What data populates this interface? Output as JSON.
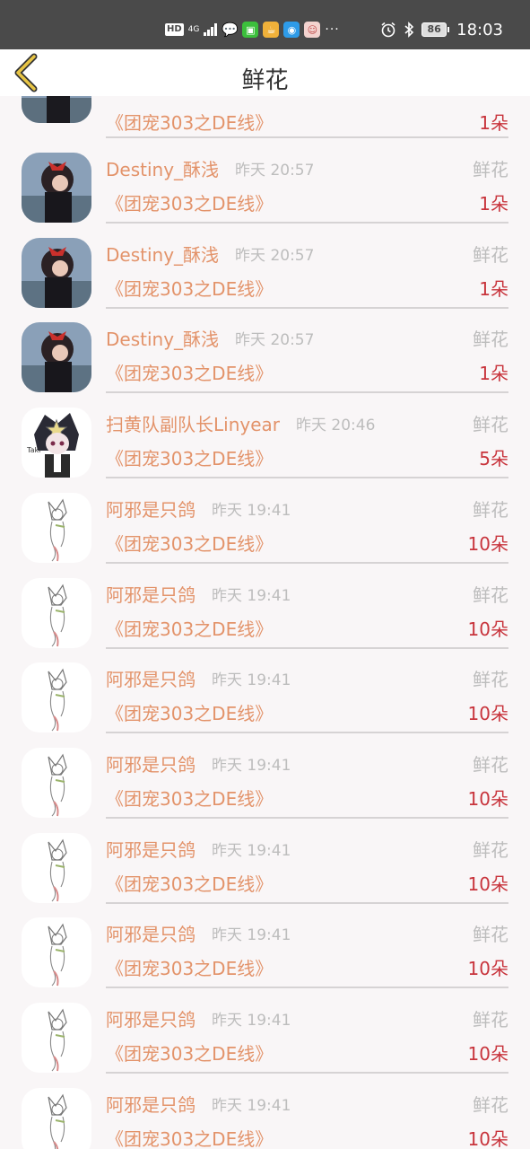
{
  "status_bar": {
    "hd": "HD",
    "network": "4G",
    "dots": "···",
    "battery": "86",
    "time": "18:03"
  },
  "header": {
    "title": "鲜花"
  },
  "list": {
    "partial_first": {
      "work": "《团宠303之DE线》",
      "count": "1朵"
    },
    "rows": [
      {
        "name": "Destiny_酥浅",
        "time": "昨天 20:57",
        "label": "鲜花",
        "work": "《团宠303之DE线》",
        "count": "1朵",
        "avatar": "girl-avatar"
      },
      {
        "name": "Destiny_酥浅",
        "time": "昨天 20:57",
        "label": "鲜花",
        "work": "《团宠303之DE线》",
        "count": "1朵",
        "avatar": "girl-avatar"
      },
      {
        "name": "Destiny_酥浅",
        "time": "昨天 20:57",
        "label": "鲜花",
        "work": "《团宠303之DE线》",
        "count": "1朵",
        "avatar": "girl-avatar"
      },
      {
        "name": "扫黄队副队长Linyear",
        "time": "昨天 20:46",
        "label": "鲜花",
        "work": "《团宠303之DE线》",
        "count": "5朵",
        "avatar": "chibi-avatar"
      },
      {
        "name": "阿邪是只鸽",
        "time": "昨天 19:41",
        "label": "鲜花",
        "work": "《团宠303之DE线》",
        "count": "10朵",
        "avatar": "sketch-avatar"
      },
      {
        "name": "阿邪是只鸽",
        "time": "昨天 19:41",
        "label": "鲜花",
        "work": "《团宠303之DE线》",
        "count": "10朵",
        "avatar": "sketch-avatar"
      },
      {
        "name": "阿邪是只鸽",
        "time": "昨天 19:41",
        "label": "鲜花",
        "work": "《团宠303之DE线》",
        "count": "10朵",
        "avatar": "sketch-avatar"
      },
      {
        "name": "阿邪是只鸽",
        "time": "昨天 19:41",
        "label": "鲜花",
        "work": "《团宠303之DE线》",
        "count": "10朵",
        "avatar": "sketch-avatar"
      },
      {
        "name": "阿邪是只鸽",
        "time": "昨天 19:41",
        "label": "鲜花",
        "work": "《团宠303之DE线》",
        "count": "10朵",
        "avatar": "sketch-avatar"
      },
      {
        "name": "阿邪是只鸽",
        "time": "昨天 19:41",
        "label": "鲜花",
        "work": "《团宠303之DE线》",
        "count": "10朵",
        "avatar": "sketch-avatar"
      },
      {
        "name": "阿邪是只鸽",
        "time": "昨天 19:41",
        "label": "鲜花",
        "work": "《团宠303之DE线》",
        "count": "10朵",
        "avatar": "sketch-avatar"
      },
      {
        "name": "阿邪是只鸽",
        "time": "昨天 19:41",
        "label": "鲜花",
        "work": "《团宠303之DE线》",
        "count": "10朵",
        "avatar": "sketch-avatar"
      }
    ]
  },
  "colors": {
    "name": "#e3936a",
    "count": "#c8343c",
    "muted": "#bdbdbd",
    "back_icon": "#e8c545"
  }
}
